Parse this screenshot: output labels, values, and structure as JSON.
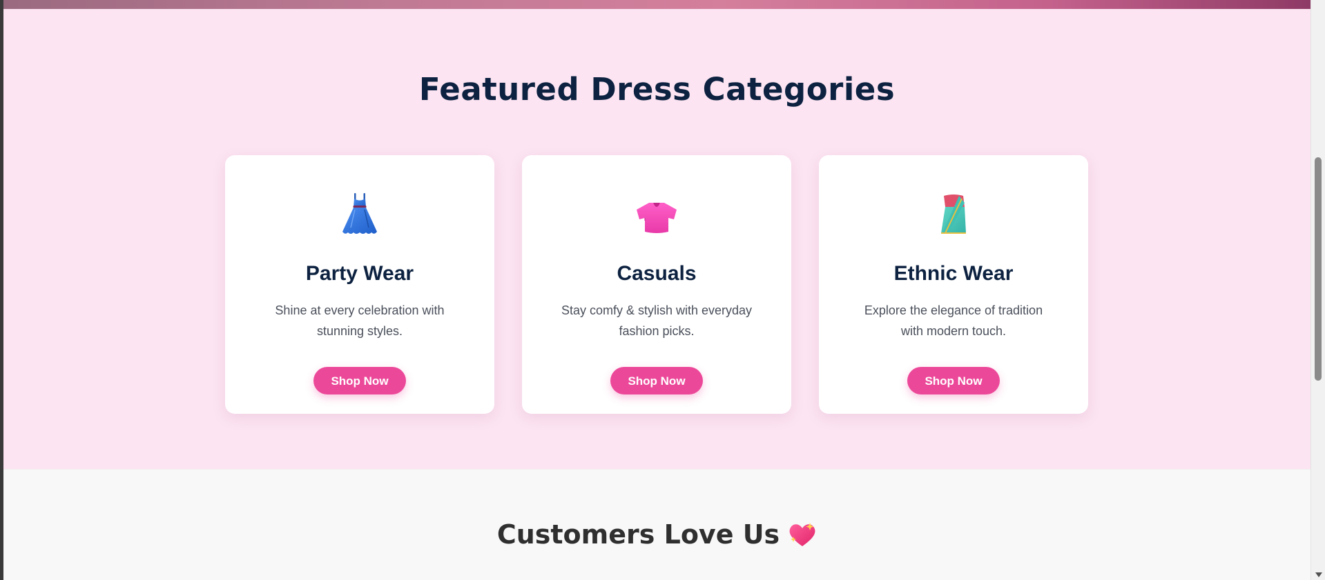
{
  "featured": {
    "title": "Featured Dress Categories",
    "cards": [
      {
        "icon": "dress-icon",
        "title": "Party Wear",
        "description": "Shine at every celebration with stunning styles.",
        "button": "Shop Now"
      },
      {
        "icon": "tshirt-icon",
        "title": "Casuals",
        "description": "Stay comfy & stylish with everyday fashion picks.",
        "button": "Shop Now"
      },
      {
        "icon": "sari-icon",
        "title": "Ethnic Wear",
        "description": "Explore the elegance of tradition with modern touch.",
        "button": "Shop Now"
      }
    ]
  },
  "testimonials": {
    "title": "Customers Love Us",
    "icon": "sparkling-heart-icon"
  },
  "colors": {
    "section_bg": "#fce4f2",
    "heading": "#0d2240",
    "accent": "#ec4899",
    "testimonial_bg": "#f8f8f8"
  }
}
